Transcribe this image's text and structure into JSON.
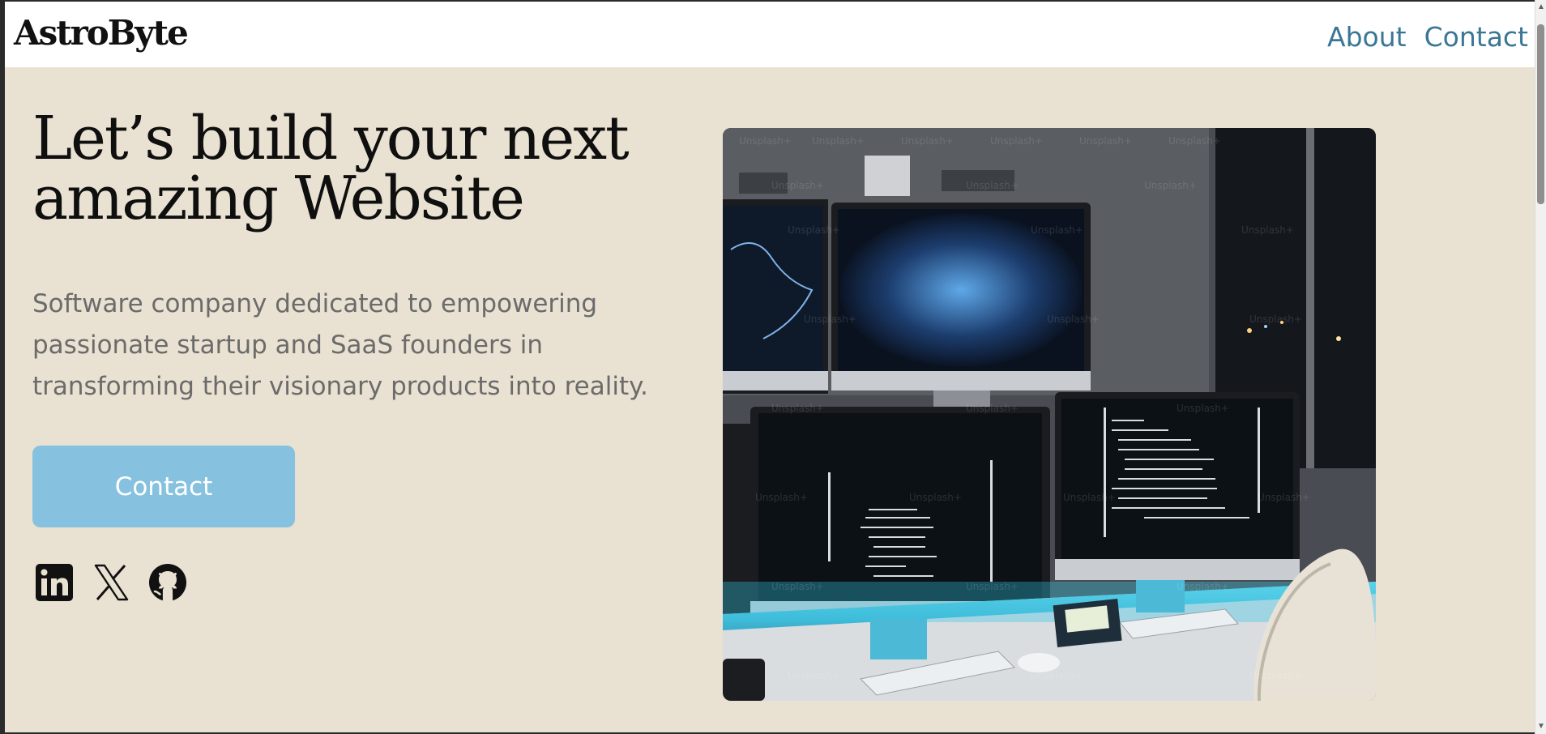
{
  "brand": {
    "name": "AstroByte"
  },
  "nav": {
    "about": "About",
    "contact": "Contact"
  },
  "hero": {
    "headline": "Let’s build your next amazing Website",
    "tagline": "Software company dedicated to empowering passionate startup and SaaS founders in transforming their visionary products into reality.",
    "cta_label": "Contact",
    "image_watermark": "Unsplash+"
  },
  "socials": [
    {
      "icon": "linkedin-icon"
    },
    {
      "icon": "x-icon"
    },
    {
      "icon": "github-icon"
    }
  ],
  "colors": {
    "page_bg": "#e9e1d1",
    "nav_bg": "#ffffff",
    "link": "#3a7796",
    "cta_bg": "#86c2df",
    "headline": "#0f0f0f",
    "tagline": "#6b6b6b"
  }
}
